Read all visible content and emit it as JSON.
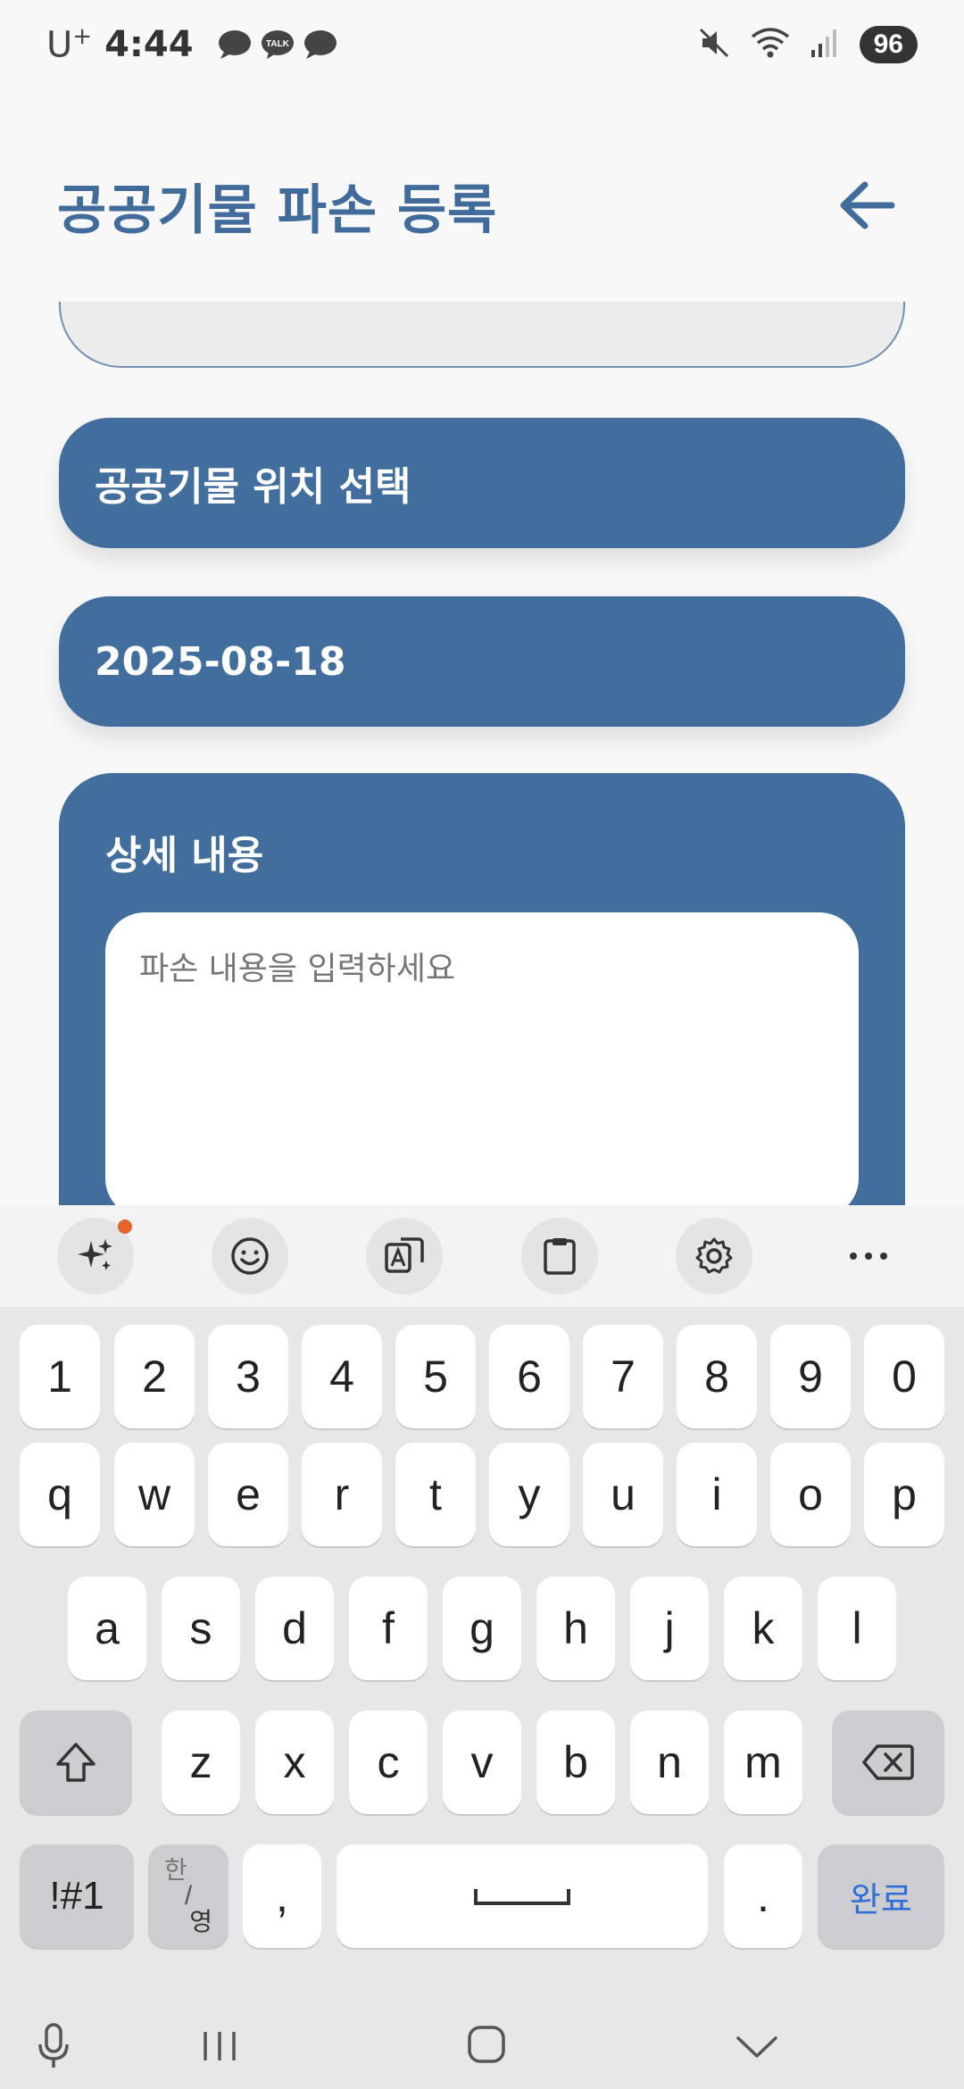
{
  "status_bar": {
    "carrier": "U",
    "carrier_sup": "+",
    "time": "4:44",
    "notification_icons": [
      "chat-bubble-icon",
      "kakaotalk-icon",
      "chat-bubble-icon"
    ],
    "talk_label": "TALK",
    "battery": "96"
  },
  "header": {
    "title": "공공기물 파손 등록",
    "back_icon": "arrow-left-icon"
  },
  "form": {
    "location_button_label": "공공기물 위치 선택",
    "date_value": "2025-08-18",
    "detail_title": "상세 내용",
    "detail_placeholder": "파손 내용을 입력하세요",
    "detail_value": ""
  },
  "keyboard": {
    "toolbar": [
      "ai-sparkle-icon",
      "emoji-icon",
      "translate-icon",
      "clipboard-icon",
      "settings-icon",
      "more-icon"
    ],
    "number_row": [
      "1",
      "2",
      "3",
      "4",
      "5",
      "6",
      "7",
      "8",
      "9",
      "0"
    ],
    "row1": [
      "q",
      "w",
      "e",
      "r",
      "t",
      "y",
      "u",
      "i",
      "o",
      "p"
    ],
    "row2": [
      "a",
      "s",
      "d",
      "f",
      "g",
      "h",
      "j",
      "k",
      "l"
    ],
    "row3": [
      "z",
      "x",
      "c",
      "v",
      "b",
      "n",
      "m"
    ],
    "symbols_label": "!#1",
    "hangul_top": "한",
    "hangul_bottom": "영",
    "comma": ",",
    "period": ".",
    "done_label": "완료"
  },
  "colors": {
    "primary": "#426e9e",
    "title": "#416b9b",
    "background": "#f8f8f9",
    "done_text": "#2f6fd6"
  }
}
